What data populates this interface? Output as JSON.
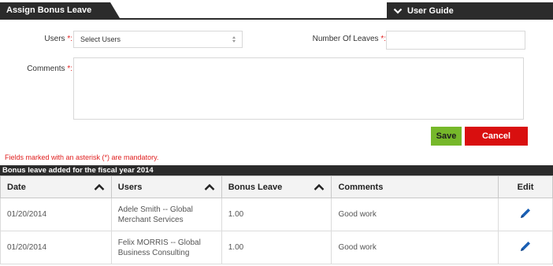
{
  "header": {
    "title": "Assign Bonus Leave",
    "guide_label": "User Guide"
  },
  "form": {
    "users_label": "Users",
    "users_select": "Select Users",
    "leaves_label": "Number Of Leaves",
    "leaves_value": "",
    "comments_label": "Comments",
    "comments_value": "",
    "required_mark": "*:",
    "save_label": "Save",
    "cancel_label": "Cancel",
    "mandatory_note": "Fields marked with an asterisk (*) are mandatory."
  },
  "section": {
    "title": "Bonus leave added for the fiscal year 2014"
  },
  "table": {
    "columns": [
      "Date",
      "Users",
      "Bonus Leave",
      "Comments",
      "Edit"
    ],
    "rows": [
      {
        "date": "01/20/2014",
        "user": "Adele Smith -- Global Merchant Services",
        "bonus": "1.00",
        "comment": "Good work"
      },
      {
        "date": "01/20/2014",
        "user": "Felix MORRIS -- Global Business Consulting",
        "bonus": "1.00",
        "comment": "Good work"
      }
    ]
  },
  "colors": {
    "dark": "#2b2b2b",
    "save": "#76b82a",
    "cancel": "#d90f0f",
    "required": "#e02020",
    "edit_icon": "#1a5fb4"
  },
  "icons": [
    "chevron-down-icon",
    "sort-up-icon",
    "pencil-icon",
    "select-arrows-icon"
  ]
}
